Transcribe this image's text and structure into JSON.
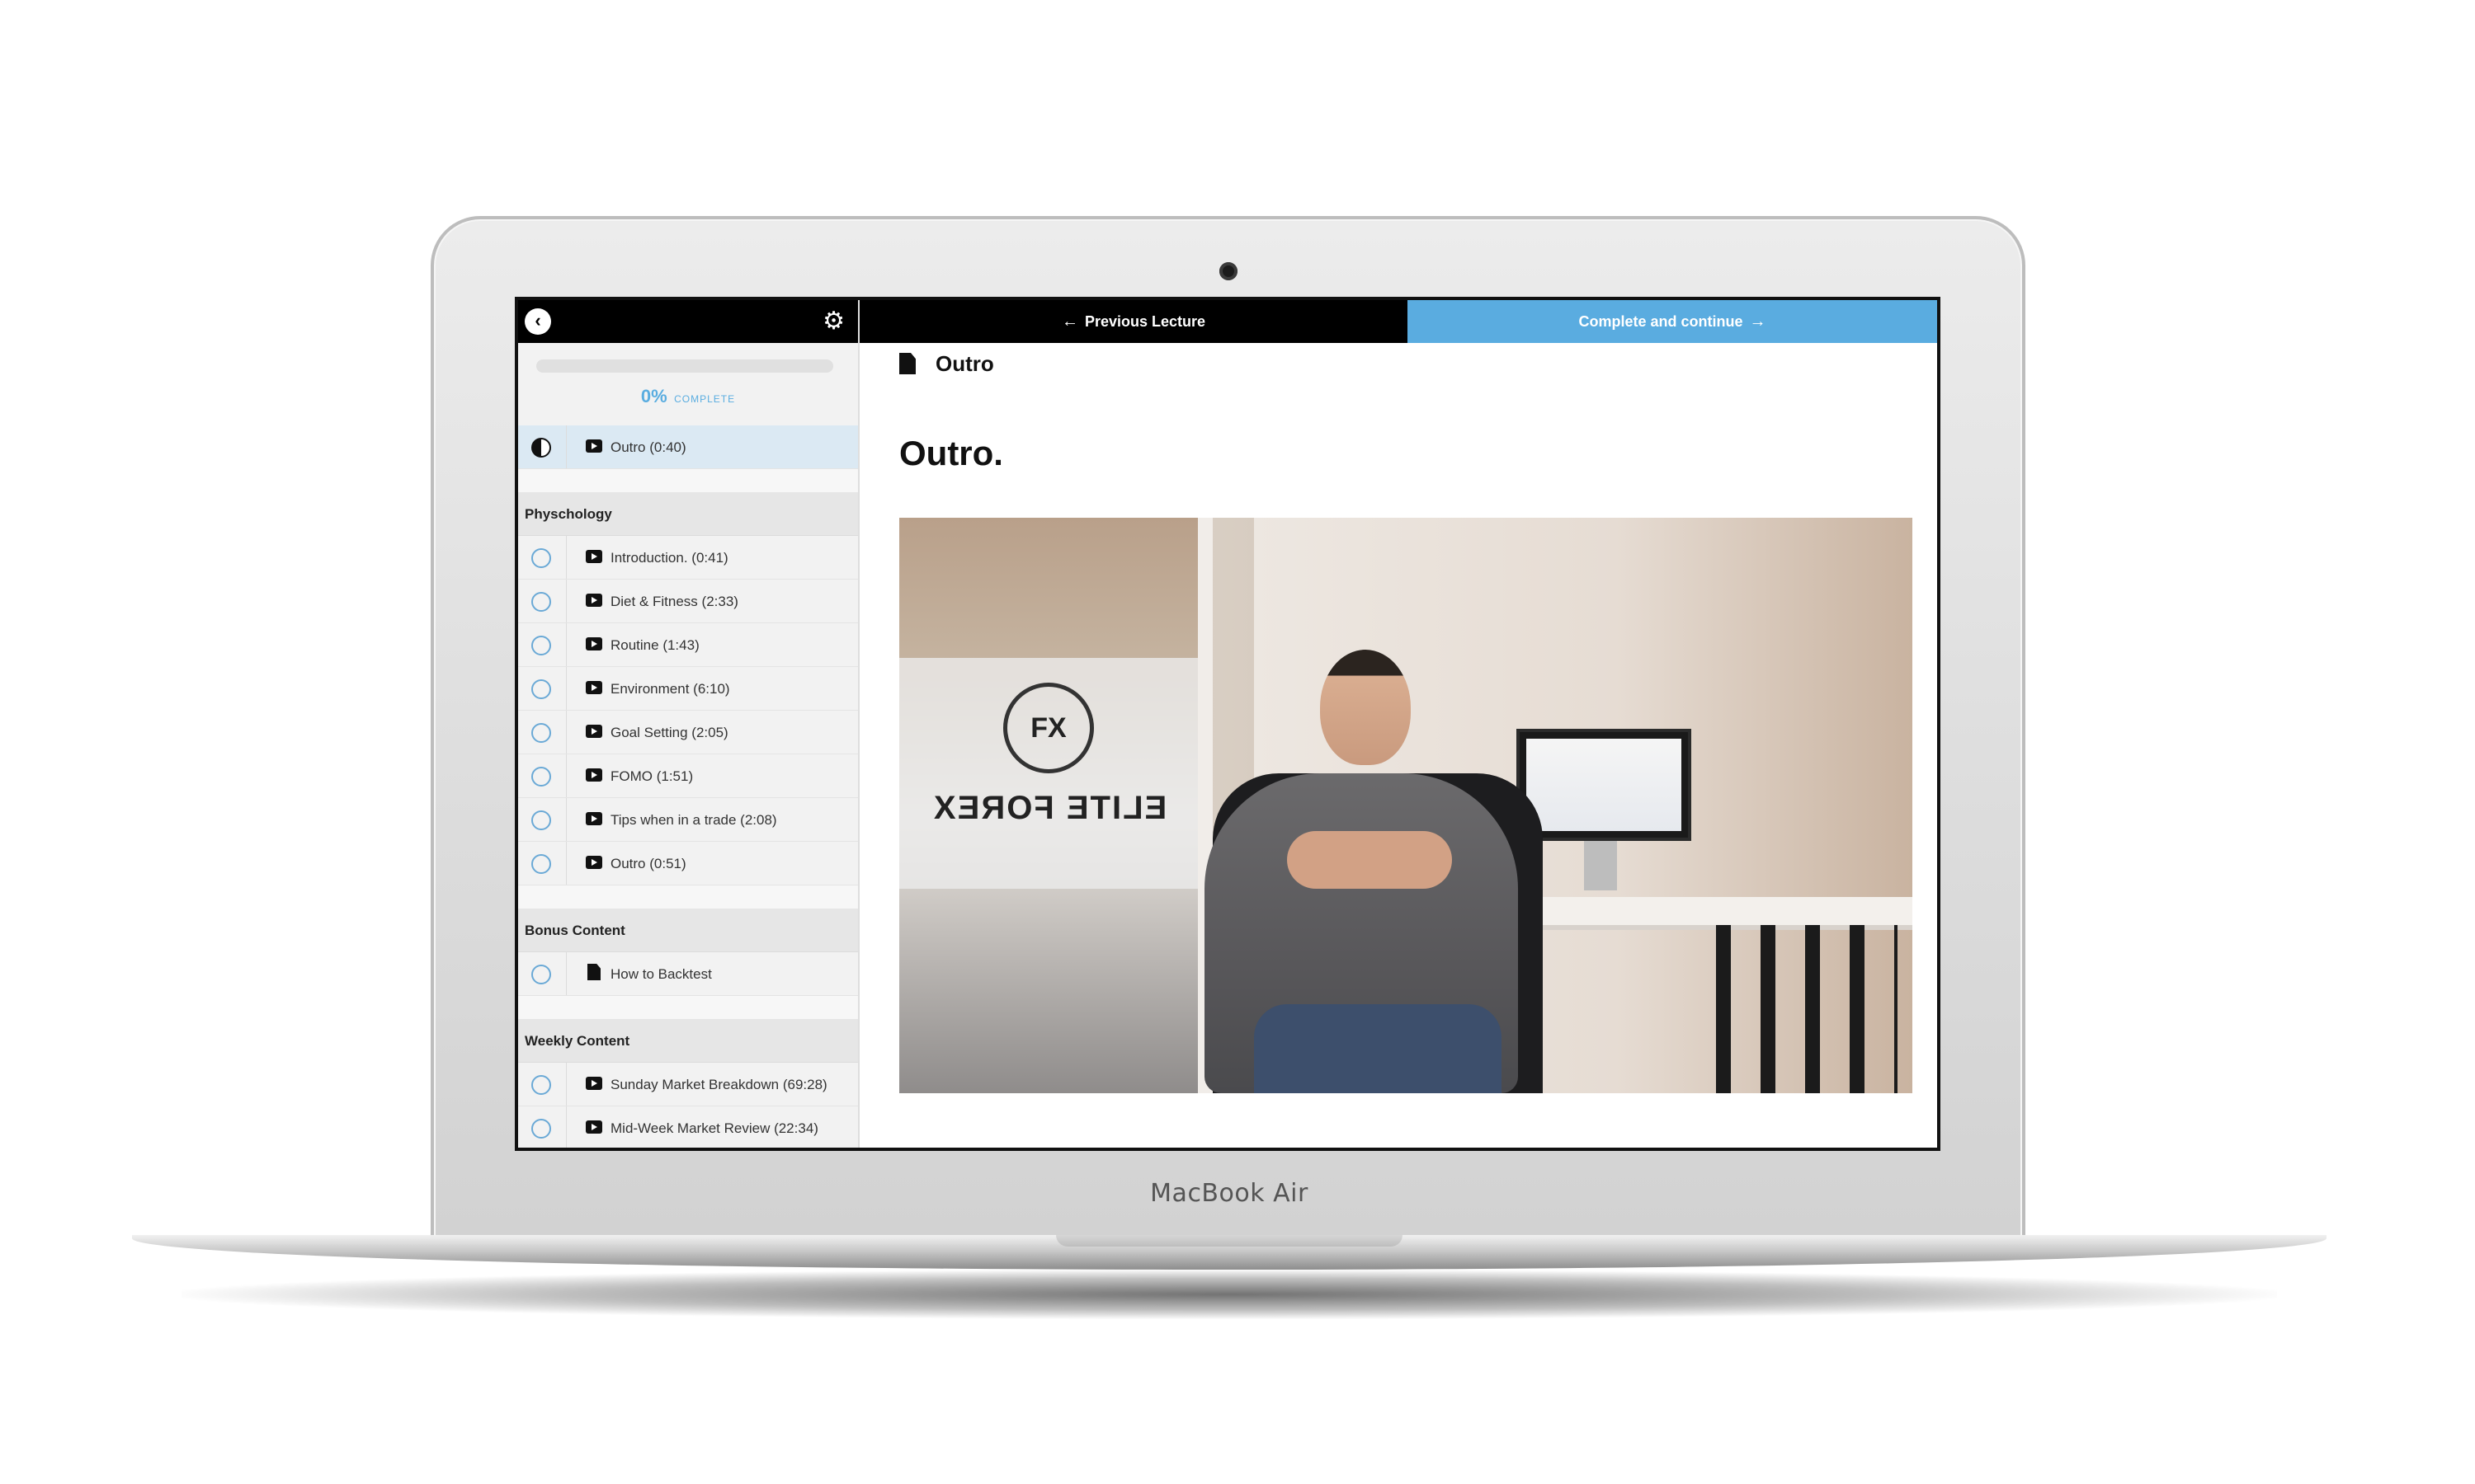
{
  "device": {
    "brand_label": "MacBook Air"
  },
  "colors": {
    "accent": "#5aace0",
    "topbar_dark": "#000000",
    "active_row": "#dbe9f3"
  },
  "sidebar": {
    "progress": {
      "percent_label": "0%",
      "word": "COMPLETE",
      "value": 0
    },
    "current": {
      "title": "Outro (0:40)",
      "icon": "play-video-icon",
      "status": "in-progress"
    },
    "sections": [
      {
        "title": "Physchology",
        "lectures": [
          {
            "title": "Introduction. (0:41)",
            "icon": "play-video-icon"
          },
          {
            "title": "Diet & Fitness (2:33)",
            "icon": "play-video-icon"
          },
          {
            "title": "Routine (1:43)",
            "icon": "play-video-icon"
          },
          {
            "title": "Environment (6:10)",
            "icon": "play-video-icon"
          },
          {
            "title": "Goal Setting (2:05)",
            "icon": "play-video-icon"
          },
          {
            "title": "FOMO (1:51)",
            "icon": "play-video-icon"
          },
          {
            "title": "Tips when in a trade (2:08)",
            "icon": "play-video-icon"
          },
          {
            "title": "Outro (0:51)",
            "icon": "play-video-icon"
          }
        ]
      },
      {
        "title": "Bonus Content",
        "lectures": [
          {
            "title": "How to Backtest",
            "icon": "document-icon"
          }
        ]
      },
      {
        "title": "Weekly Content",
        "lectures": [
          {
            "title": "Sunday Market Breakdown (69:28)",
            "icon": "play-video-icon"
          },
          {
            "title": "Mid-Week Market Review (22:34)",
            "icon": "play-video-icon"
          }
        ]
      }
    ]
  },
  "topbar": {
    "prev_label": "Previous Lecture",
    "next_label": "Complete and continue"
  },
  "content": {
    "header_title": "Outro",
    "heading": "Outro.",
    "video_scene": {
      "logo_mark": "FX",
      "logo_text": "ELITE FOREX"
    }
  }
}
